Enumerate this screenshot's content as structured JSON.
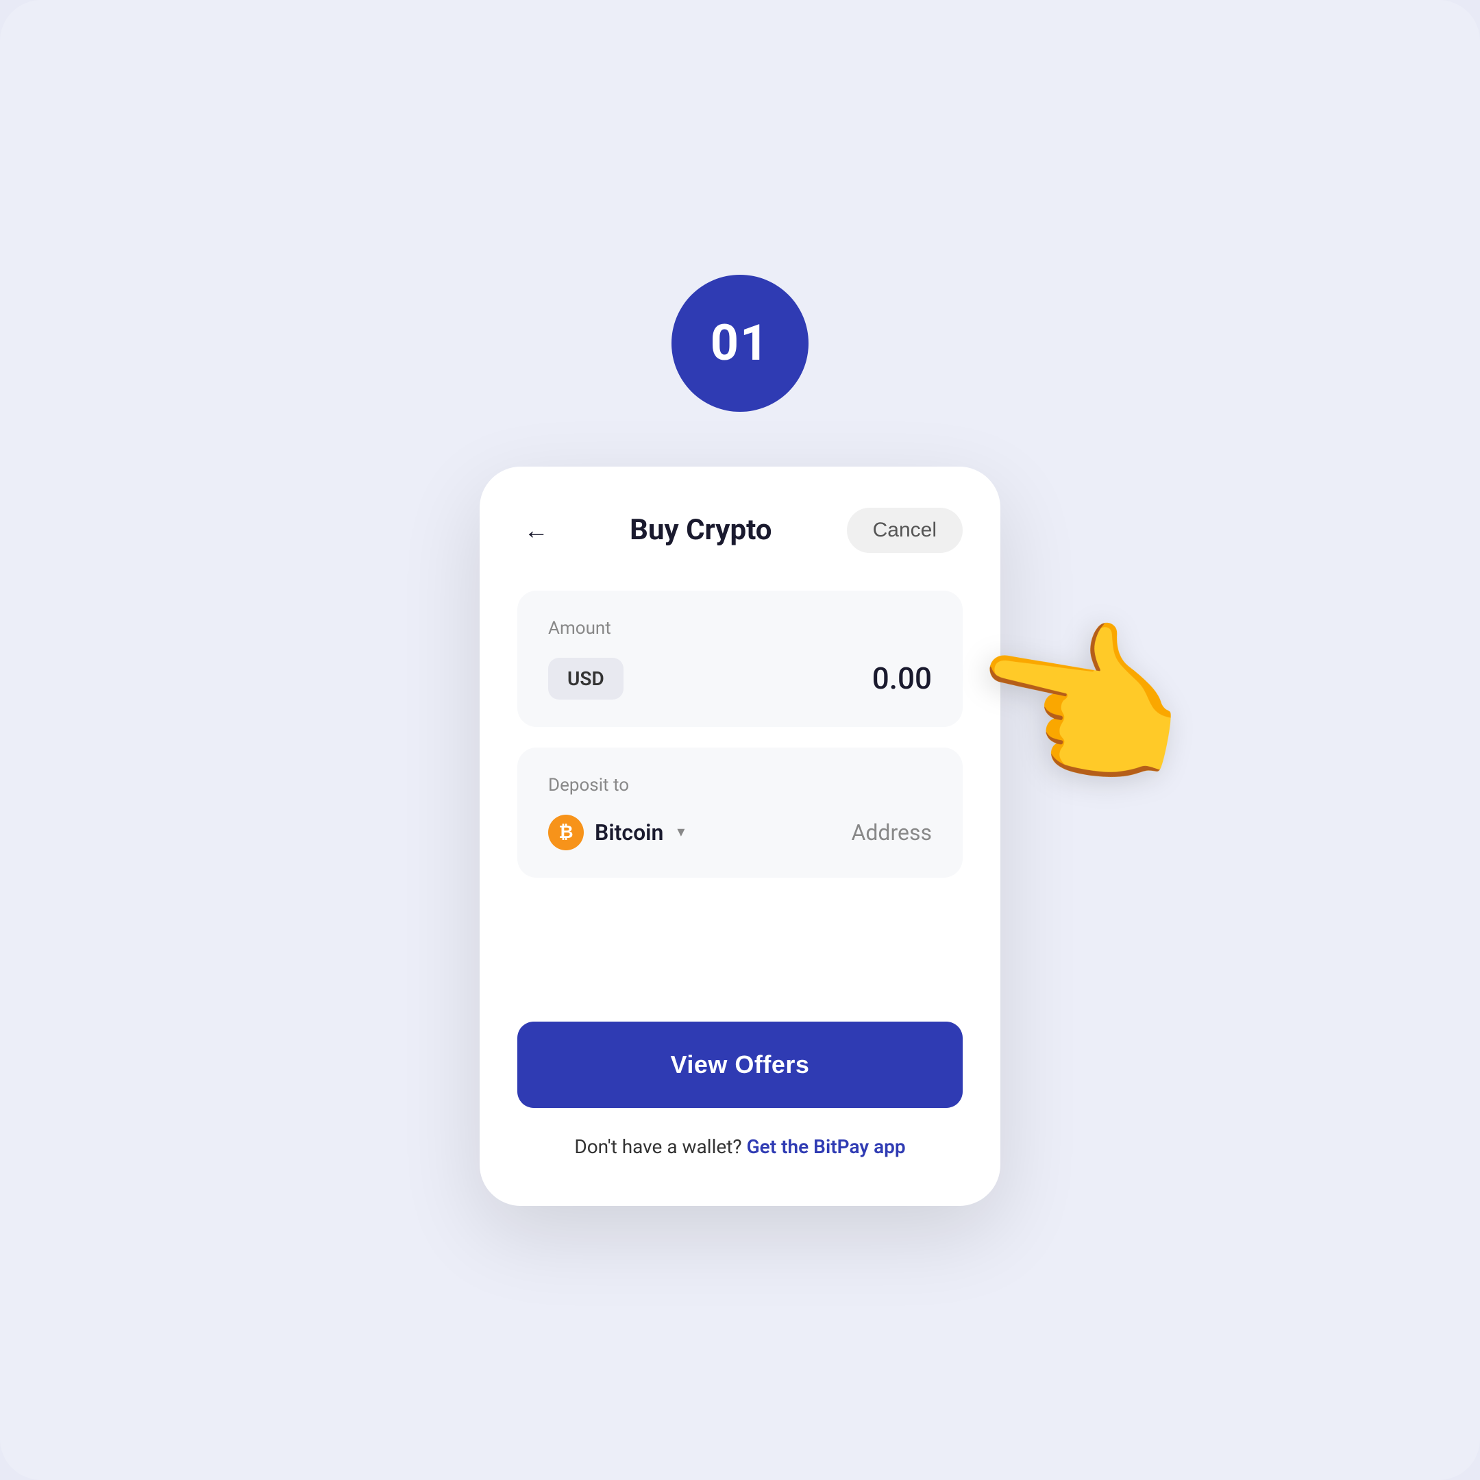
{
  "page": {
    "background_color": "#eceef8"
  },
  "step_badge": {
    "number": "01",
    "bg_color": "#2f3bb3"
  },
  "header": {
    "title": "Buy Crypto",
    "cancel_label": "Cancel",
    "back_icon": "←"
  },
  "amount_section": {
    "label": "Amount",
    "currency": "USD",
    "value": "0.00"
  },
  "deposit_section": {
    "label": "Deposit to",
    "crypto_name": "Bitcoin",
    "address_label": "Address",
    "crypto_symbol": "₿",
    "crypto_color": "#f7931a"
  },
  "actions": {
    "view_offers_label": "View Offers",
    "wallet_prompt": "Don't have a wallet?",
    "wallet_link": "Get the BitPay app"
  }
}
